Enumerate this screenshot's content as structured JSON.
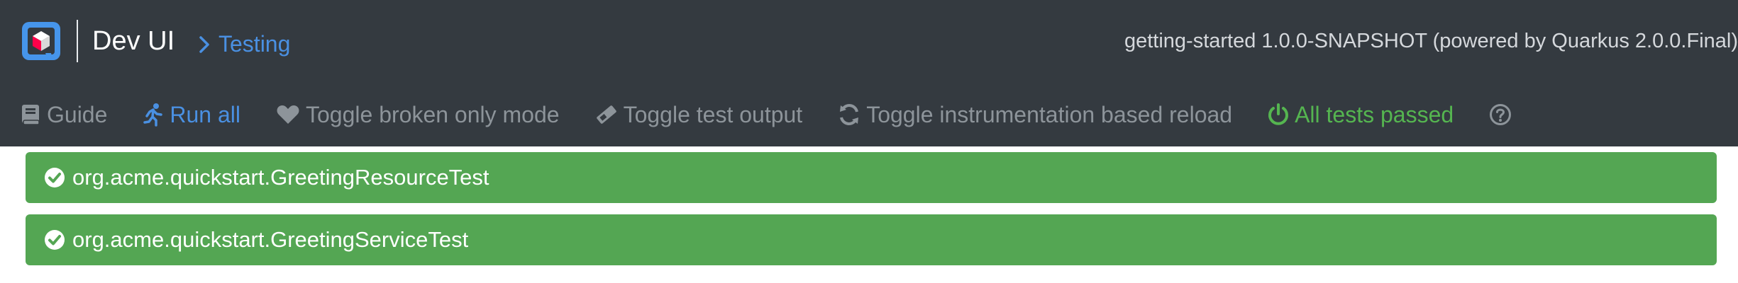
{
  "header": {
    "title": "Dev UI",
    "breadcrumb": "Testing",
    "app_info": "getting-started 1.0.0-SNAPSHOT (powered by Quarkus 2.0.0.Final)"
  },
  "toolbar": {
    "guide": "Guide",
    "run_all": "Run all",
    "toggle_broken": "Toggle broken only mode",
    "toggle_output": "Toggle test output",
    "toggle_instrumentation": "Toggle instrumentation based reload",
    "status": "All tests passed"
  },
  "results": [
    {
      "name": "org.acme.quickstart.GreetingResourceTest",
      "status": "passed"
    },
    {
      "name": "org.acme.quickstart.GreetingServiceTest",
      "status": "passed"
    }
  ],
  "colors": {
    "topbar": "#343a40",
    "link": "#4a90e2",
    "muted": "#8d949a",
    "success": "#55b550",
    "result_bg": "#54a653"
  }
}
